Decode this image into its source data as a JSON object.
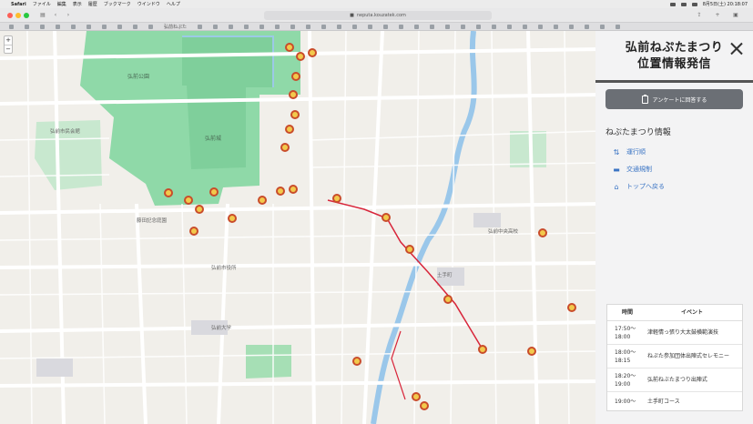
{
  "menubar": {
    "app": "Safari",
    "items": [
      "ファイル",
      "編集",
      "表示",
      "履歴",
      "ブックマーク",
      "ウインドウ",
      "ヘルプ"
    ],
    "clock": "8月5日(土) 20:18:07"
  },
  "browser": {
    "url": "neputa.kouzatek.com",
    "tab_label": "弘前ねぷた"
  },
  "panel": {
    "title_line1": "弘前ねぷたまつり",
    "title_line2": "位置情報発信",
    "survey_button": "アンケートに回答する",
    "section_title": "ねぷたまつり情報",
    "links": [
      {
        "label": "運行順",
        "icon": "sort-icon"
      },
      {
        "label": "交通規制",
        "icon": "car-icon"
      },
      {
        "label": "トップへ戻る",
        "icon": "home-icon"
      }
    ]
  },
  "schedule": {
    "header_time": "時間",
    "header_event": "イベント",
    "rows": [
      {
        "time": "17:50〜\n18:00",
        "event": "津軽情っ張り大太鼓横範演技"
      },
      {
        "time": "18:00〜\n18:15",
        "event": "ねぷた参加団体出陣式セレモニー"
      },
      {
        "time": "18:20〜\n19:00",
        "event": "弘前ねぶたまつり出陣式"
      },
      {
        "time": "19:00〜",
        "event": "土手町コース"
      }
    ]
  },
  "map_labels": [
    "弘前城",
    "弘前公園",
    "弘前市役所",
    "弘前大学",
    "土手町",
    "弘前中央高校",
    "藤田記念庭園",
    "弘前市民会館"
  ],
  "colors": {
    "route": "#d8253a",
    "park": "#8fd9a8",
    "link": "#3a74c4",
    "survey_button": "#6b6f75"
  }
}
